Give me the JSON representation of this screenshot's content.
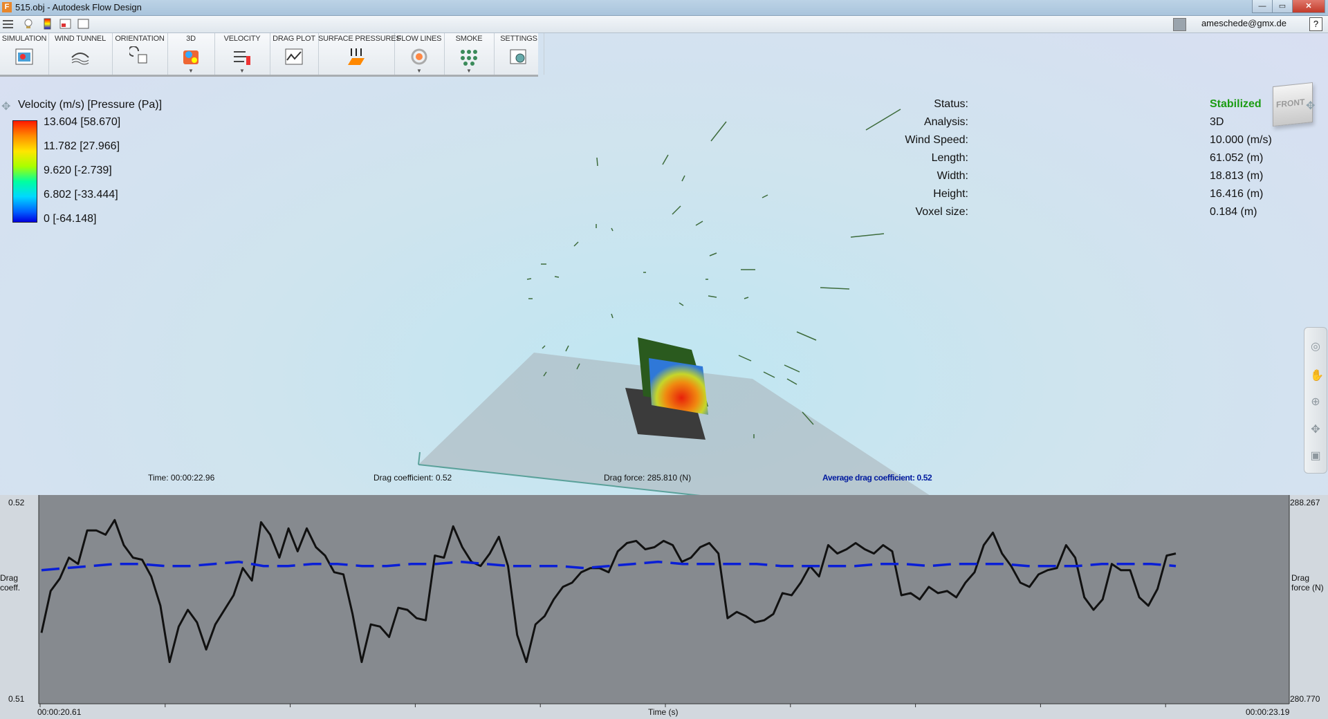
{
  "window": {
    "title": "515.obj - Autodesk Flow Design",
    "app_icon_letter": "F",
    "minimize": "—",
    "maximize": "▭",
    "close": "✕"
  },
  "user": {
    "email": "ameschede@gmx.de",
    "help": "?"
  },
  "ribbon": [
    {
      "label": "SIMULATION",
      "icon": "simulation-icon",
      "dropdown": false
    },
    {
      "label": "WIND TUNNEL",
      "icon": "wind-tunnel-icon",
      "dropdown": false
    },
    {
      "label": "ORIENTATION",
      "icon": "orientation-icon",
      "dropdown": false
    },
    {
      "label": "3D",
      "icon": "3d-icon",
      "dropdown": true
    },
    {
      "label": "VELOCITY",
      "icon": "velocity-icon",
      "dropdown": true
    },
    {
      "label": "DRAG PLOT",
      "icon": "drag-plot-icon",
      "dropdown": false
    },
    {
      "label": "SURFACE PRESSURES",
      "icon": "surface-pressures-icon",
      "dropdown": false
    },
    {
      "label": "FLOW LINES",
      "icon": "flow-lines-icon",
      "dropdown": true
    },
    {
      "label": "SMOKE",
      "icon": "smoke-icon",
      "dropdown": true
    },
    {
      "label": "SETTINGS",
      "icon": "settings-icon",
      "dropdown": false
    }
  ],
  "legend": {
    "title": "Velocity (m/s) [Pressure (Pa)]",
    "values": [
      "13.604 [58.670]",
      "11.782 [27.966]",
      "9.620 [-2.739]",
      "6.802 [-33.444]",
      "0 [-64.148]"
    ]
  },
  "info": [
    {
      "key": "Status:",
      "value": "Stabilized"
    },
    {
      "key": "Analysis:",
      "value": "3D"
    },
    {
      "key": "Wind Speed:",
      "value": "10.000 (m/s)"
    },
    {
      "key": "Length:",
      "value": "61.052 (m)"
    },
    {
      "key": "Width:",
      "value": "18.813 (m)"
    },
    {
      "key": "Height:",
      "value": "16.416 (m)"
    },
    {
      "key": "Voxel size:",
      "value": "0.184 (m)"
    }
  ],
  "view_cube": {
    "label": "FRONT"
  },
  "overlay": {
    "time": "Time: 00:00:22.96",
    "drag_coefficient": "Drag coefficient: 0.52",
    "drag_force": "Drag force: 285.810 (N)",
    "avg_drag": "Average drag coefficient: 0.52"
  },
  "colors": {
    "status_ok": "#1b9c12",
    "avg_line": "#0a1fd6",
    "drag_line": "#111111",
    "chart_bg": "#868a8f"
  },
  "chart_data": {
    "type": "line",
    "title": "",
    "xlabel": "Time (s)",
    "ylabel_left": "Drag coeff.",
    "ylabel_right": "Drag force (N)",
    "x_start_label": "00:00:20.61",
    "x_end_label": "00:00:23.19",
    "y_left_ticks": [
      "0.52",
      "0.51"
    ],
    "y_right_ticks": [
      "288.267",
      "280.770"
    ],
    "ylim": [
      0.51,
      0.52
    ],
    "grid": false,
    "series": [
      {
        "name": "",
        "style": "solid",
        "values": [
          0.5134,
          0.5154,
          0.516,
          0.517,
          0.5167,
          0.5183,
          0.5183,
          0.5181,
          0.5188,
          0.5176,
          0.517,
          0.5169,
          0.5161,
          0.5147,
          0.512,
          0.5137,
          0.5145,
          0.5139,
          0.5126,
          0.5138,
          0.5145,
          0.5152,
          0.5165,
          0.5159,
          0.5187,
          0.5181,
          0.517,
          0.5184,
          0.5173,
          0.5184,
          0.5175,
          0.5171,
          0.5163,
          0.5162,
          0.5143,
          0.512,
          0.5138,
          0.5137,
          0.5132,
          0.5146,
          0.5145,
          0.5141,
          0.514,
          0.5171,
          0.517,
          0.5185,
          0.5175,
          0.5168,
          0.5166,
          0.5172,
          0.518,
          0.5166,
          0.5133,
          0.512,
          0.5138,
          0.5142,
          0.515,
          0.5156,
          0.5158,
          0.5163,
          0.5165,
          0.5165,
          0.5163,
          0.5173,
          0.5177,
          0.5178,
          0.5174,
          0.5175,
          0.5178,
          0.5176,
          0.5168,
          0.517,
          0.5175,
          0.5177,
          0.5172,
          0.5141,
          0.5144,
          0.5142,
          0.5139,
          0.514,
          0.5143,
          0.5153,
          0.5152,
          0.5158,
          0.5166,
          0.5161,
          0.5176,
          0.5172,
          0.5174,
          0.5177,
          0.5174,
          0.5172,
          0.5176,
          0.5173,
          0.5152,
          0.5153,
          0.515,
          0.5156,
          0.5153,
          0.5154,
          0.5151,
          0.5158,
          0.5163,
          0.5176,
          0.5182,
          0.5172,
          0.5166,
          0.5158,
          0.5156,
          0.5162,
          0.5164,
          0.5165,
          0.5176,
          0.517,
          0.5151,
          0.5145,
          0.515,
          0.5167,
          0.5164,
          0.5164,
          0.5151,
          0.5147,
          0.5155,
          0.5171,
          0.5172
        ]
      },
      {
        "name": "",
        "style": "dashed",
        "values": [
          0.5164,
          0.5165,
          0.5166,
          0.5167,
          0.5167,
          0.5166,
          0.5166,
          0.5167,
          0.5168,
          0.5166,
          0.5166,
          0.5167,
          0.5167,
          0.5166,
          0.5166,
          0.5167,
          0.5167,
          0.5168,
          0.5167,
          0.5166,
          0.5166,
          0.5166,
          0.5165,
          0.5166,
          0.5167,
          0.5168,
          0.5167,
          0.5167,
          0.5167,
          0.5167,
          0.5166,
          0.5166,
          0.5166,
          0.5166,
          0.5167,
          0.5167,
          0.5166,
          0.5167,
          0.5167,
          0.5167,
          0.5166,
          0.5166,
          0.5166,
          0.5167,
          0.5167,
          0.5167,
          0.5166
        ]
      }
    ]
  }
}
